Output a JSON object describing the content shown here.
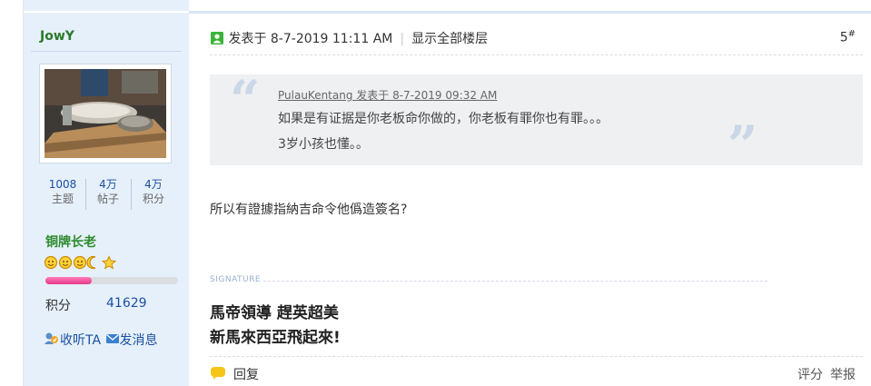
{
  "user": {
    "name": "JowY",
    "stats": [
      {
        "value": "1008",
        "label": "主题"
      },
      {
        "value": "4万",
        "label": "帖子"
      },
      {
        "value": "4万",
        "label": "积分"
      }
    ],
    "rank_title": "铜牌长老",
    "rank_progress_fraction": 0.35,
    "points_label": "积分",
    "points_value": "41629",
    "follow_label": "收听TA",
    "message_label": "发消息"
  },
  "post": {
    "posted_label": "发表于 8-7-2019 11:11 AM",
    "show_all_label": "显示全部楼层",
    "floor_number": "5",
    "floor_mark": "#",
    "quote": {
      "meta": "PulauKentang 发表于 8-7-2019 09:32 AM",
      "line1": "如果是有证据是你老板命你做的，你老板有罪你也有罪。。。",
      "line2": "3岁小孩也懂。。"
    },
    "body": "所以有證據指納吉命令他僞造簽名?",
    "signature_label": "SIGNATURE",
    "signature_line1": "馬帝領導  趕英超美",
    "signature_line2": "新馬來西亞飛起來!",
    "reply_label": "回复",
    "rate_label": "评分",
    "report_label": "举报"
  },
  "colors": {
    "sidebar_bg": "#e6f0fb",
    "link": "#1a4fa0",
    "username": "#2a7a2a",
    "rank": "#2f8c2f",
    "progress": "#e43a8c"
  },
  "icons": [
    "online-status-icon",
    "rank-star-icons",
    "follow-icon",
    "message-icon",
    "reply-bubble-icon",
    "quote-open-icon",
    "quote-close-icon"
  ]
}
